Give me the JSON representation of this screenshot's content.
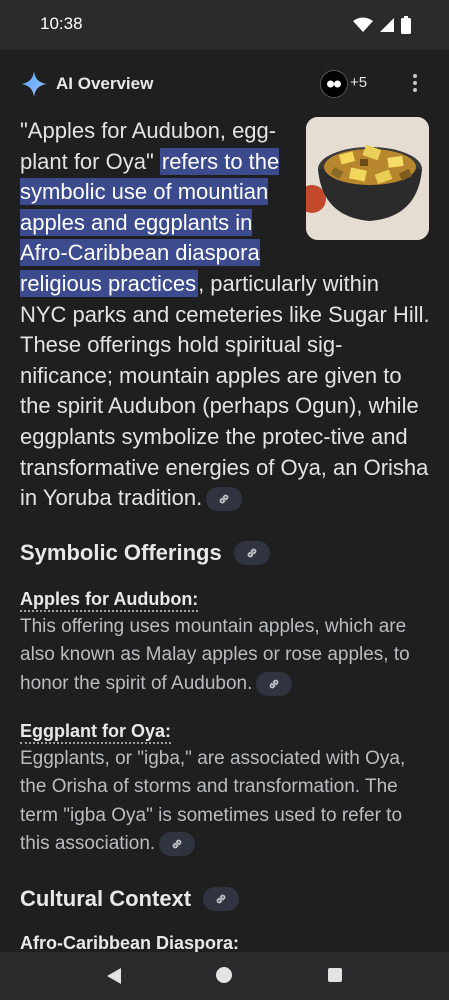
{
  "status": {
    "time": "10:38"
  },
  "overview": {
    "title": "AI Overview",
    "sources_more": "+5",
    "lead_plain_1": "\"Apples for Audubon, egg-plant for Oya\" ",
    "lead_highlight": "refers to the symbolic use of mountian apples and eggplants in Afro-Caribbean diaspora religious practices",
    "lead_plain_2": ", particularly within NYC parks and cemeteries like Sugar Hill. These offerings hold spiritual sig-nificance; mountain apples are given to the spirit Audubon (perhaps Ogun), while eggplants symbolize the protec-tive and transformative energies of Oya, an Orisha in Yoruba tradition."
  },
  "sections": {
    "symbolic": {
      "heading": "Symbolic Offerings",
      "apples_title": "Apples for Audubon:",
      "apples_text": "This offering uses mountain apples, which are also known as Malay apples or rose apples, to honor the spirit of Audubon.",
      "eggplant_title": "Eggplant for Oya:",
      "eggplant_text": "Eggplants, or \"igba,\" are associated with Oya, the Orisha of storms and transformation. The term \"igba Oya\" is sometimes used to refer to this association."
    },
    "cultural": {
      "heading": "Cultural Context",
      "sub_title": "Afro-Caribbean Diaspora:"
    }
  },
  "icons": {
    "sparkle": "sparkle-icon",
    "link": "link-icon",
    "more": "more-vert-icon",
    "wifi": "wifi-icon",
    "signal": "signal-icon",
    "battery": "battery-icon"
  },
  "colors": {
    "highlight": "#3c4b8e",
    "background": "#1f1f1f",
    "accent": "#7cacf8"
  }
}
